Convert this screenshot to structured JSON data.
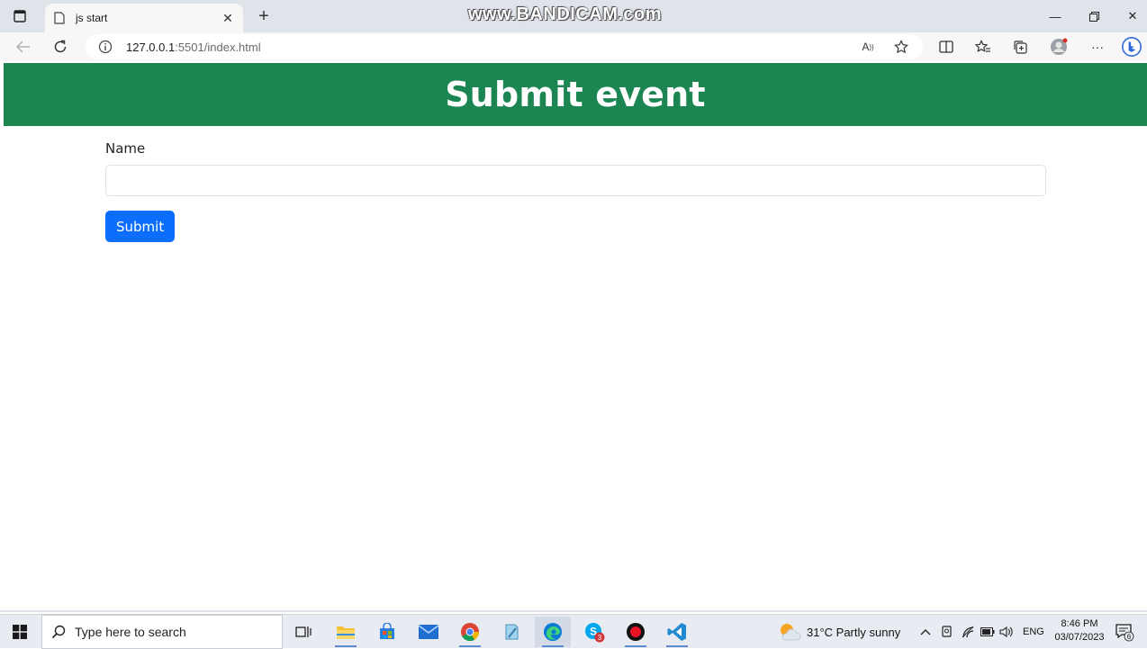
{
  "browser": {
    "tab_title": "js start",
    "watermark": "www.BANDICAM.com",
    "url_host": "127.0.0.1",
    "url_rest": ":5501/index.html"
  },
  "page": {
    "heading": "Submit event",
    "name_label": "Name",
    "name_value": "",
    "submit_label": "Submit"
  },
  "taskbar": {
    "search_placeholder": "Type here to search",
    "weather": "31°C  Partly sunny",
    "language": "ENG",
    "time": "8:46 PM",
    "date": "03/07/2023",
    "notification_count": "6",
    "skype_badge": "3"
  },
  "colors": {
    "header_bg": "#1c8653",
    "button_bg": "#0d6efd",
    "titlebar_bg": "#dfe3ea"
  }
}
